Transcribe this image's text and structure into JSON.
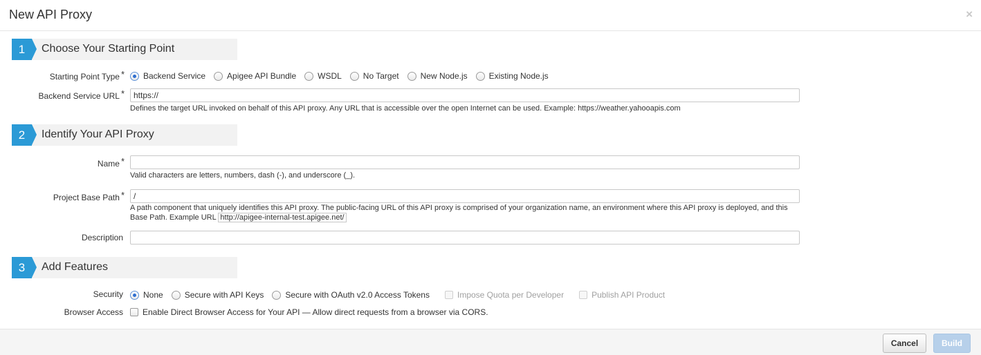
{
  "dialog": {
    "title": "New API Proxy",
    "close_glyph": "×"
  },
  "sections": [
    {
      "number": "1",
      "title": "Choose Your Starting Point"
    },
    {
      "number": "2",
      "title": "Identify Your API Proxy"
    },
    {
      "number": "3",
      "title": "Add Features"
    }
  ],
  "starting_point": {
    "label": "Starting Point Type",
    "required_mark": "*",
    "options": [
      "Backend Service",
      "Apigee API Bundle",
      "WSDL",
      "No Target",
      "New Node.js",
      "Existing Node.js"
    ],
    "selected": "Backend Service"
  },
  "backend_url": {
    "label": "Backend Service URL",
    "required_mark": "*",
    "value": "https://",
    "help": "Defines the target URL invoked on behalf of this API proxy. Any URL that is accessible over the open Internet can be used. Example: https://weather.yahooapis.com"
  },
  "name": {
    "label": "Name",
    "required_mark": "*",
    "value": "",
    "help": "Valid characters are letters, numbers, dash (-), and underscore (_)."
  },
  "base_path": {
    "label": "Project Base Path",
    "required_mark": "*",
    "value": "/",
    "help_line1": "A path component that uniquely identifies this API proxy. The public-facing URL of this API proxy is comprised of your organization name, an environment where this API proxy is deployed, and this",
    "help_line2_prefix": "Base Path. Example URL",
    "example_url": "http://apigee-internal-test.apigee.net/"
  },
  "description": {
    "label": "Description",
    "value": ""
  },
  "security": {
    "label": "Security",
    "options": [
      "None",
      "Secure with API Keys",
      "Secure with OAuth v2.0 Access Tokens"
    ],
    "selected": "None",
    "extra_checkboxes": [
      "Impose Quota per Developer",
      "Publish API Product"
    ]
  },
  "browser_access": {
    "label": "Browser Access",
    "checkbox_label": "Enable Direct Browser Access for Your API — Allow direct requests from a browser via CORS."
  },
  "footer": {
    "cancel_label": "Cancel",
    "build_label": "Build"
  },
  "colors": {
    "accent": "#2b9ad6",
    "build_disabled": "#b7d0ea"
  }
}
